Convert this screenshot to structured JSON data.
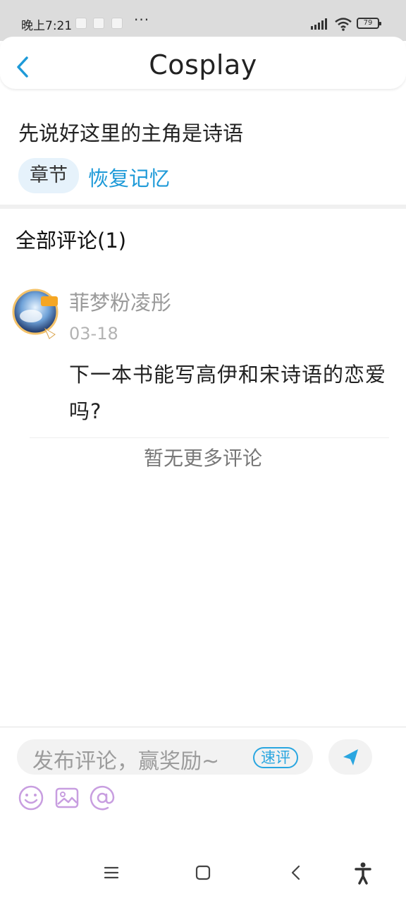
{
  "status_bar": {
    "time": "晚上7:21",
    "overflow": "···",
    "battery": "79"
  },
  "header": {
    "title": "Cosplay",
    "back_icon": "chevron-left-icon"
  },
  "post": {
    "text": "先说好这里的主角是诗语",
    "chip_label": "章节",
    "chapter_link": "恢复记忆"
  },
  "comments": {
    "title": "全部评论(1)",
    "items": [
      {
        "username": "菲梦粉凌彤",
        "date": "03-18",
        "text": "下一本书能写高伊和宋诗语的恋爱吗?",
        "avatar_badge": "作者"
      }
    ],
    "no_more": "暂无更多评论"
  },
  "composer": {
    "placeholder": "发布评论，赢奖励~",
    "speed_label": "速评",
    "tools": [
      "emoji-icon",
      "image-icon",
      "mention-icon"
    ],
    "send_icon": "send-icon"
  },
  "colors": {
    "accent": "#1e9ad8",
    "chip_bg": "#e6f2fb",
    "tool_icon": "#c89ee0"
  },
  "nav_bar": {
    "icons": [
      "menu-icon",
      "home-icon",
      "back-icon",
      "accessibility-icon"
    ]
  }
}
